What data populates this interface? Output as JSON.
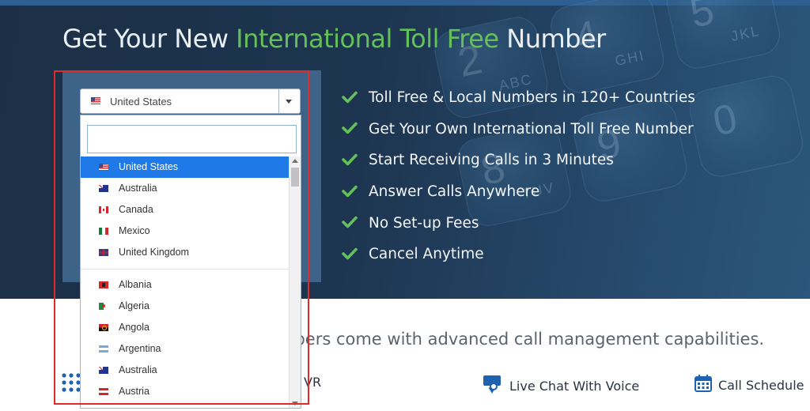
{
  "hero": {
    "title_prefix": "Get Your New ",
    "title_accent": "International Toll Free",
    "title_suffix": " Number",
    "accent_color": "#63c05a",
    "features": [
      "Toll Free & Local Numbers in 120+ Countries",
      "Get Your Own International Toll Free Number",
      "Start Receiving Calls in 3 Minutes",
      "Answer Calls Anywhere",
      "No Set-up Fees",
      "Cancel Anytime"
    ],
    "keypad_keys": [
      {
        "digit": "2",
        "letters": "ABC"
      },
      {
        "digit": "4",
        "letters": "GHI"
      },
      {
        "digit": "5",
        "letters": "JKL"
      },
      {
        "digit": "8",
        "letters": "TUV"
      },
      {
        "digit": "9",
        "letters": ""
      },
      {
        "digit": "0",
        "letters": ""
      }
    ]
  },
  "country_select": {
    "selected": "United States",
    "search_value": "",
    "search_placeholder": "",
    "selected_color": "#1f7ae8",
    "popular": [
      {
        "name": "United States",
        "flag": "us",
        "selected": true
      },
      {
        "name": "Australia",
        "flag": "au"
      },
      {
        "name": "Canada",
        "flag": "ca"
      },
      {
        "name": "Mexico",
        "flag": "mx"
      },
      {
        "name": "United Kingdom",
        "flag": "uk"
      }
    ],
    "all": [
      {
        "name": "Albania",
        "flag": "al"
      },
      {
        "name": "Algeria",
        "flag": "dz"
      },
      {
        "name": "Angola",
        "flag": "ao"
      },
      {
        "name": "Argentina",
        "flag": "ar"
      },
      {
        "name": "Australia",
        "flag": "au"
      },
      {
        "name": "Austria",
        "flag": "at"
      }
    ]
  },
  "lower": {
    "subtitle_visible": "mbers come with advanced call management capabilities.",
    "partial_feature": "VR",
    "features": [
      {
        "label": "Live Chat With Voice",
        "icon": "chat-icon"
      },
      {
        "label": "Call Schedule",
        "icon": "calendar-icon"
      }
    ]
  }
}
